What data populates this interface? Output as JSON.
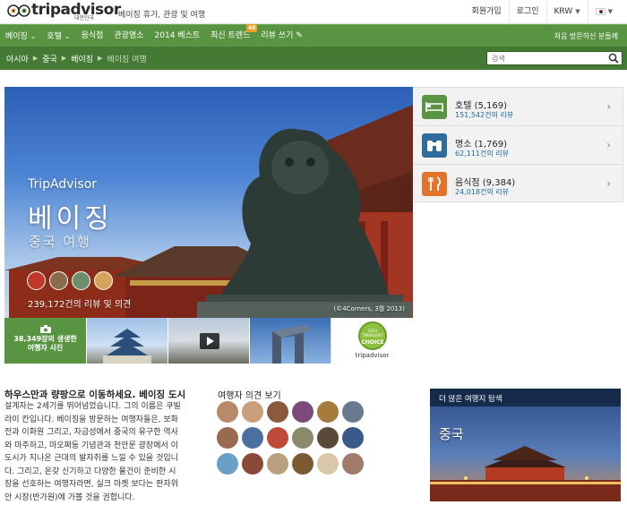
{
  "topbar": {
    "logo_text": "tripadvisor",
    "logo_sub": "대한민국",
    "tagline": "베이징 휴가, 관광 및 여행",
    "links": [
      "회원가입",
      "로그인",
      "KRW"
    ]
  },
  "nav": {
    "items": [
      "베이징",
      "호텔",
      "음식점",
      "관광명소",
      "2014 베스트",
      "최신 트렌드",
      "리뷰 쓰기"
    ],
    "badge": "48",
    "right": "처음 방문하신 분들께"
  },
  "breadcrumb": [
    "아시아",
    "중국",
    "베이징",
    "베이징 여행"
  ],
  "search": {
    "placeholder": "검색"
  },
  "hero": {
    "brand": "TripAdvisor",
    "city": "베이징",
    "subtitle": "중국 여행",
    "reviews": "239,172건의 리뷰 및 의견",
    "credit": "(©4Corners, 3월 2013)"
  },
  "thumbs": {
    "photos_count": "38,349장의 생생한",
    "photos_label": "여행자 사진",
    "award_year": "2014",
    "award_name": "TRAVELERS'",
    "award_choice": "CHOICE",
    "award_brand": "tripadvisor"
  },
  "categories": [
    {
      "title": "호텔 (5,169)",
      "sub": "151,542건의 리뷰",
      "color": "#589442",
      "icon": "bed-icon"
    },
    {
      "title": "명소 (1,769)",
      "sub": "62,111건의 리뷰",
      "color": "#2e6c9e",
      "icon": "binoculars-icon"
    },
    {
      "title": "음식점 (9,384)",
      "sub": "24,018건의 리뷰",
      "color": "#e0742a",
      "icon": "fork-knife-icon"
    }
  ],
  "intro": {
    "title": "하우스만과 량팡으로 이동하세요. 베이징 도시",
    "lines": [
      "설계자는 2세기를 뛰어넘었습니다. 그의 이름은 쿠빌",
      "라이 칸입니다. 베이징을 방문하는 여행자들은, 보화",
      "전과 이화원 그리고, 자금성에서 중국의 유구한 역사",
      "와 마주하고, 마오쩌둥 기념관과 천안문 광장에서 이",
      "도시가 지나온 근대의 발자취를 느낄 수 있을 것입니",
      "다. 그리고, 온갖 신기하고 다양한 물건이 준비한 시",
      "장을 선호하는 여행자라면, 실크 마켓 보다는 판자위",
      "안 시장(반가원)에 가볼 것을 권합니다."
    ]
  },
  "opinions": {
    "title": "여행자 의견 보기"
  },
  "explore": {
    "label": "더 많은 여행지 탐색",
    "name": "중국"
  }
}
